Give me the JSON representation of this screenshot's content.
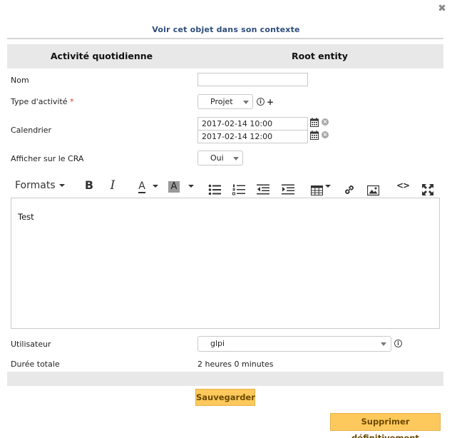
{
  "dialog": {
    "close_symbol": "✖",
    "context_link": "Voir cet objet dans son contexte"
  },
  "header": {
    "left": "Activité quotidienne",
    "right": "Root entity"
  },
  "form": {
    "nom": {
      "label": "Nom",
      "value": ""
    },
    "type": {
      "label": "Type d'activité",
      "required_mark": "*",
      "selected": "Projet",
      "add_symbol": "+"
    },
    "calendrier": {
      "label": "Calendrier",
      "start": "2017-02-14 10:00",
      "end": "2017-02-14 12:00"
    },
    "afficher": {
      "label": "Afficher sur le CRA",
      "selected": "Oui"
    },
    "editor": {
      "toolbar": {
        "formats_label": "Formats",
        "bold_symbol": "B",
        "italic_symbol": "I",
        "text_color_symbol": "A",
        "bg_color_symbol": "A",
        "source_code_symbol": "<>"
      },
      "content": "Test"
    },
    "utilisateur": {
      "label": "Utilisateur",
      "selected": "glpi"
    },
    "duree": {
      "label": "Durée totale",
      "value": "2 heures 0 minutes"
    }
  },
  "actions": {
    "save_label": "Sauvegarder",
    "delete_label": "Supprimer définitivement"
  },
  "colors": {
    "accent_button": "#fec95c",
    "link": "#2d4c7c",
    "header_bg": "#e8e8e8",
    "required": "#dd3333"
  }
}
